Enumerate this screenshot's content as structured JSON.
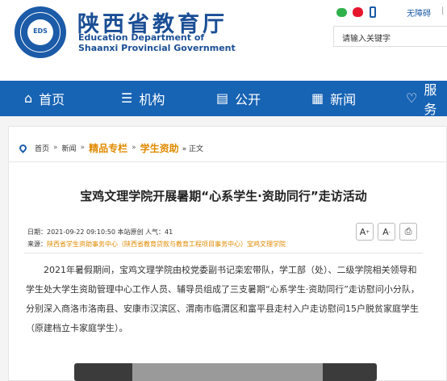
{
  "header": {
    "title_cn": "陕西省教育厅",
    "title_en_line1": "Education Department of",
    "title_en_line2": "Shaanxi Provincial Government",
    "logo": {
      "center_text": "EDS"
    },
    "accessibility_link": "无障碍",
    "accessibility_sep": "|",
    "search_placeholder": "请输入关键字",
    "icons": [
      "wechat-icon",
      "weibo-icon",
      "mobile-icon"
    ]
  },
  "nav": {
    "items": [
      {
        "label": "首页",
        "icon": "home-icon",
        "glyph": "⌂"
      },
      {
        "label": "机构",
        "icon": "list-icon",
        "glyph": "☰"
      },
      {
        "label": "公开",
        "icon": "document-icon",
        "glyph": "▤"
      },
      {
        "label": "新闻",
        "icon": "newspaper-icon",
        "glyph": "▦"
      },
      {
        "label": "服务",
        "icon": "heart-icon",
        "glyph": "♡"
      }
    ]
  },
  "breadcrumb": {
    "home": "首页",
    "sep": "»",
    "news": "新闻",
    "featured": "精品专栏",
    "student_aid": "学生资助",
    "current": "» 正文"
  },
  "article": {
    "title": "宝鸡文理学院开展暑期“心系学生·资助同行”走访活动",
    "meta_line1": "日期：2021-09-22 09:10:50  本站原创  人气：41",
    "meta_source_label": "来源：",
    "meta_source": "陕西省学生资助事务中心（陕西省教育贷款与教育工程项目事务中心）宝鸡文理学院",
    "tools": {
      "font_larger": "A",
      "font_smaller": "A",
      "print": "⎙"
    },
    "paragraph": "2021年暑假期间，宝鸡文理学院由校党委副书记栾宏带队，学工部（处）、二级学院相关领导和学生处大学生资助管理中心工作人员、辅导员组成了三支暑期“心系学生·资助同行”走访慰问小分队，分别深入商洛市洛南县、安康市汉滨区、渭南市临渭区和富平县走村入户走访慰问15户脱贫家庭学生（原建档立卡家庭学生）。"
  },
  "colors": {
    "brand_blue": "#1763b4",
    "highlight_orange": "#e08a00"
  }
}
